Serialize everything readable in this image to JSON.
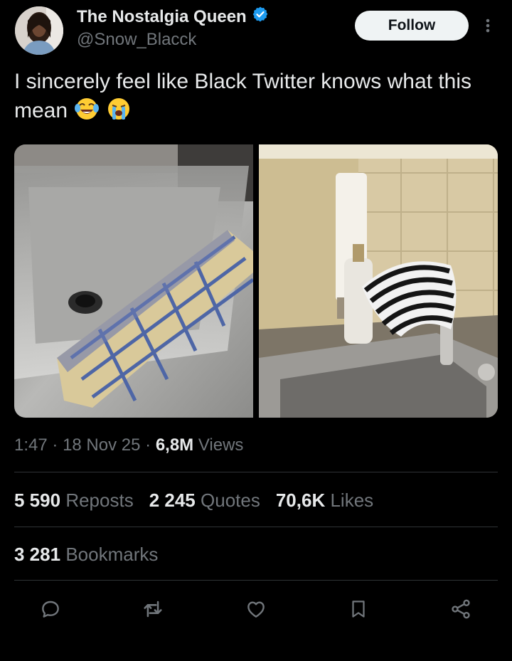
{
  "author": {
    "display_name": "The Nostalgia Queen",
    "handle": "@Snow_Blacck",
    "verified": true
  },
  "header": {
    "follow_label": "Follow"
  },
  "tweet": {
    "text": "I sincerely feel like Black Twitter knows what this mean",
    "emojis": [
      "😂",
      "😭"
    ]
  },
  "meta": {
    "time": "1:47",
    "date": "18 Nov 25",
    "views_count": "6,8M",
    "views_label": "Views"
  },
  "stats": {
    "reposts_count": "5 590",
    "reposts_label": "Reposts",
    "quotes_count": "2 245",
    "quotes_label": "Quotes",
    "likes_count": "70,6K",
    "likes_label": "Likes",
    "bookmarks_count": "3 281",
    "bookmarks_label": "Bookmarks"
  },
  "icons": {
    "reply": "reply-icon",
    "repost": "repost-icon",
    "like": "heart-icon",
    "bookmark": "bookmark-icon",
    "share": "share-icon",
    "verified": "verified-badge-icon",
    "more": "more-icon"
  },
  "colors": {
    "verified": "#1d9bf0",
    "muted_text": "#71767b",
    "background": "#000000"
  }
}
